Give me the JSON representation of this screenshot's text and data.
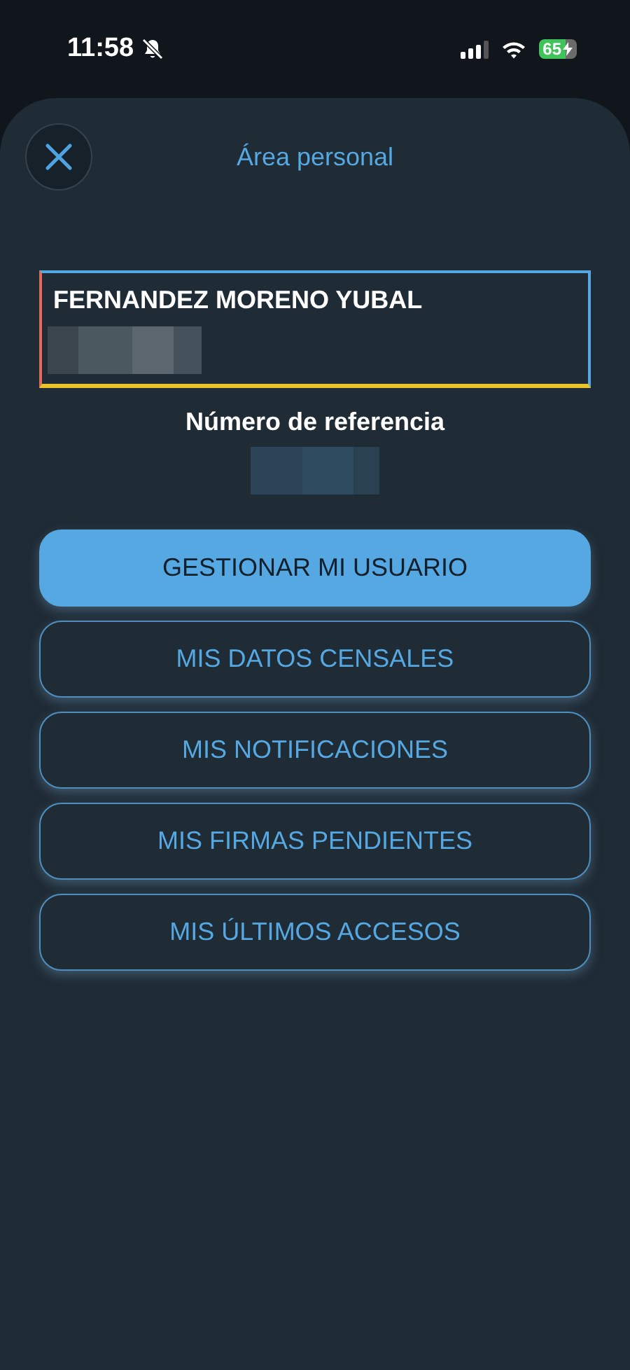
{
  "status_bar": {
    "time": "11:58",
    "silent": true,
    "battery": "65",
    "charging": true
  },
  "header": {
    "title": "Área personal"
  },
  "profile": {
    "name": "FERNANDEZ MORENO YUBAL"
  },
  "reference": {
    "label": "Número de referencia"
  },
  "menu": [
    {
      "label": "GESTIONAR MI USUARIO",
      "kind": "primary"
    },
    {
      "label": "MIS DATOS CENSALES",
      "kind": "outline"
    },
    {
      "label": "MIS NOTIFICACIONES",
      "kind": "outline"
    },
    {
      "label": "MIS FIRMAS PENDIENTES",
      "kind": "outline"
    },
    {
      "label": "MIS ÚLTIMOS ACCESOS",
      "kind": "outline"
    }
  ]
}
